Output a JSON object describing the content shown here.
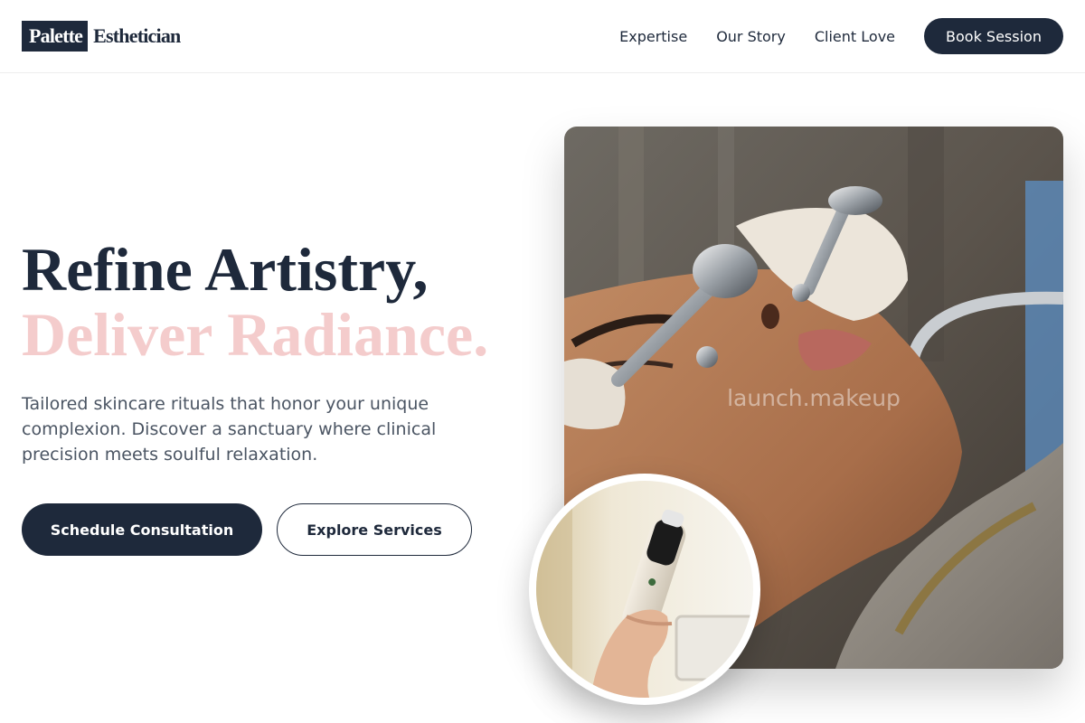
{
  "brand": {
    "logo_box": "Palette",
    "logo_text": "Esthetician"
  },
  "nav": {
    "links": [
      "Expertise",
      "Our Story",
      "Client Love"
    ],
    "cta": "Book Session"
  },
  "hero": {
    "headline_line1": "Refine Artistry,",
    "headline_line2": "Deliver Radiance.",
    "lead": "Tailored skincare rituals that honor your unique complexion. Discover a sanctuary where clinical precision meets soulful relaxation.",
    "primary_button": "Schedule Consultation",
    "secondary_button": "Explore Services"
  },
  "media": {
    "watermark": "launch.makeup"
  },
  "colors": {
    "navy": "#1e293b",
    "blush": "#f4cccc",
    "body_text": "#4b5563"
  }
}
